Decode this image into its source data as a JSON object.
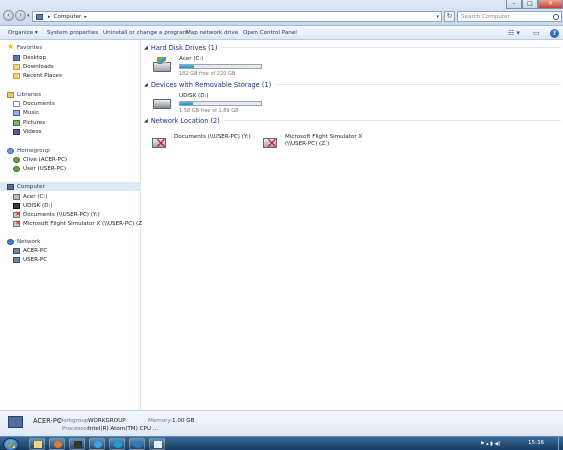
{
  "window": {
    "address_crumb": "Computer",
    "search_placeholder": "Search Computer",
    "minimize": "–",
    "maximize": "□",
    "close": "✕"
  },
  "toolbar": {
    "organize": "Organize ▾",
    "system_properties": "System properties",
    "uninstall": "Uninstall or change a program",
    "map_drive": "Map network drive",
    "control_panel": "Open Control Panel",
    "views": "☷ ▾",
    "preview": "▭",
    "help": "?"
  },
  "nav": {
    "favorites": "Favorites",
    "desktop": "Desktop",
    "downloads": "Downloads",
    "recent": "Recent Places",
    "libraries": "Libraries",
    "documents": "Documents",
    "music": "Music",
    "pictures": "Pictures",
    "videos": "Videos",
    "homegroup": "Homegroup",
    "clive": "Clive (ACER-PC)",
    "user": "User (USER-PC)",
    "computer": "Computer",
    "acer_c": "Acer (C:)",
    "udisk": "UDISK (D:)",
    "docs_y": "Documents (\\\\USER-PC) (Y:)",
    "msfs_z": "Microsoft Flight Simulator X (\\\\USER-PC) (Z:)",
    "network": "Network",
    "acer_pc": "ACER-PC",
    "user_pc": "USER-PC"
  },
  "groups": {
    "hdd": "Hard Disk Drives (1)",
    "removable": "Devices with Removable Storage (1)",
    "network": "Network Location (2)"
  },
  "drives": [
    {
      "name": "Acer (C:)",
      "free": "182 GB free of 220 GB",
      "used_fraction": 0.17
    },
    {
      "name": "UDISK (D:)",
      "free": "1.58 GB free of 1.89 GB",
      "used_fraction": 0.16
    }
  ],
  "network_locations": [
    {
      "line1": "Documents (\\\\USER-PC) (Y:)",
      "line2": ""
    },
    {
      "line1": "Microsoft Flight Simulator X",
      "line2": "(\\\\USER-PC) (Z:)"
    }
  ],
  "details": {
    "pc_name": "ACER-PC",
    "workgroup_label": "Workgroup:",
    "workgroup": "WORKGROUP",
    "memory_label": "Memory:",
    "memory": "1.00 GB",
    "processor_label": "Processor:",
    "processor": "Intel(R) Atom(TM) CPU ..."
  },
  "taskbar": {
    "clock": "15:36",
    "tray": "⚑ ▴ ▮ ◀)"
  }
}
